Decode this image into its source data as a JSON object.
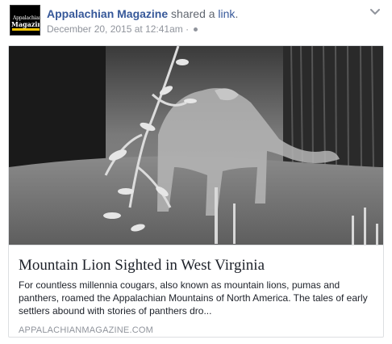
{
  "post": {
    "page_name": "Appalachian Magazine",
    "action_text": " shared a ",
    "link_word": "link",
    "period": ".",
    "timestamp": "December 20, 2015 at 12:41am",
    "separator": " · ",
    "privacy_icon": "globe-icon",
    "menu_icon": "chevron-down-icon",
    "avatar_logo": "Appalachian Magazine"
  },
  "link_preview": {
    "image_alt": "Mountain lion on trail camera at night",
    "title": "Mountain Lion Sighted in West Virginia",
    "description": "For countless millennia cougars, also known as mountain lions, pumas and panthers, roamed the Appalachian Mountains of North America. The tales of early settlers abound with stories of panthers dro...",
    "domain": "APPALACHIANMAGAZINE.COM"
  },
  "colors": {
    "link_blue": "#365899",
    "meta_gray": "#90949c",
    "border": "#dddfe2"
  }
}
